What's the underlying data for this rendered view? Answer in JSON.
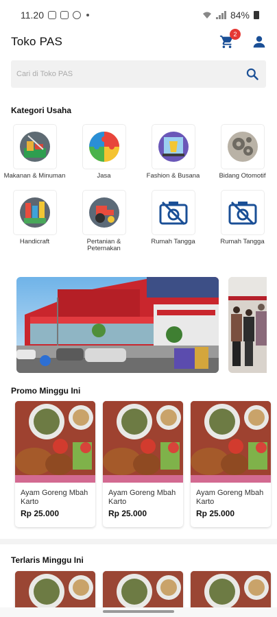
{
  "status_bar": {
    "time": "11.20",
    "battery": "84%"
  },
  "app_bar": {
    "title": "Toko PAS",
    "cart_count": "2"
  },
  "search": {
    "placeholder": "Cari di Toko PAS"
  },
  "categories": {
    "title": "Kategori Usaha",
    "items": [
      {
        "label": "Makanan & Minuman",
        "icon": "food-icon"
      },
      {
        "label": "Jasa",
        "icon": "puzzle-icon"
      },
      {
        "label": "Fashion & Busana",
        "icon": "fashion-icon"
      },
      {
        "label": "Bidang Otomotif",
        "icon": "gears-icon"
      },
      {
        "label": "Handicraft",
        "icon": "craft-icon"
      },
      {
        "label": "Pertanian & Peternakan",
        "icon": "tractor-icon"
      },
      {
        "label": "Rumah Tangga",
        "icon": "no-image-icon"
      },
      {
        "label": "Rumah Tangga",
        "icon": "no-image-icon"
      }
    ]
  },
  "promo": {
    "title": "Promo Minggu Ini",
    "products": [
      {
        "name": "Ayam Goreng Mbah Karto",
        "price": "Rp 25.000"
      },
      {
        "name": "Ayam Goreng Mbah Karto",
        "price": "Rp 25.000"
      },
      {
        "name": "Ayam Goreng Mbah Karto",
        "price": "Rp 25.000"
      }
    ]
  },
  "best_sellers": {
    "title": "Terlaris Minggu Ini"
  },
  "colors": {
    "accent": "#1a4f96",
    "badge": "#e53935"
  }
}
